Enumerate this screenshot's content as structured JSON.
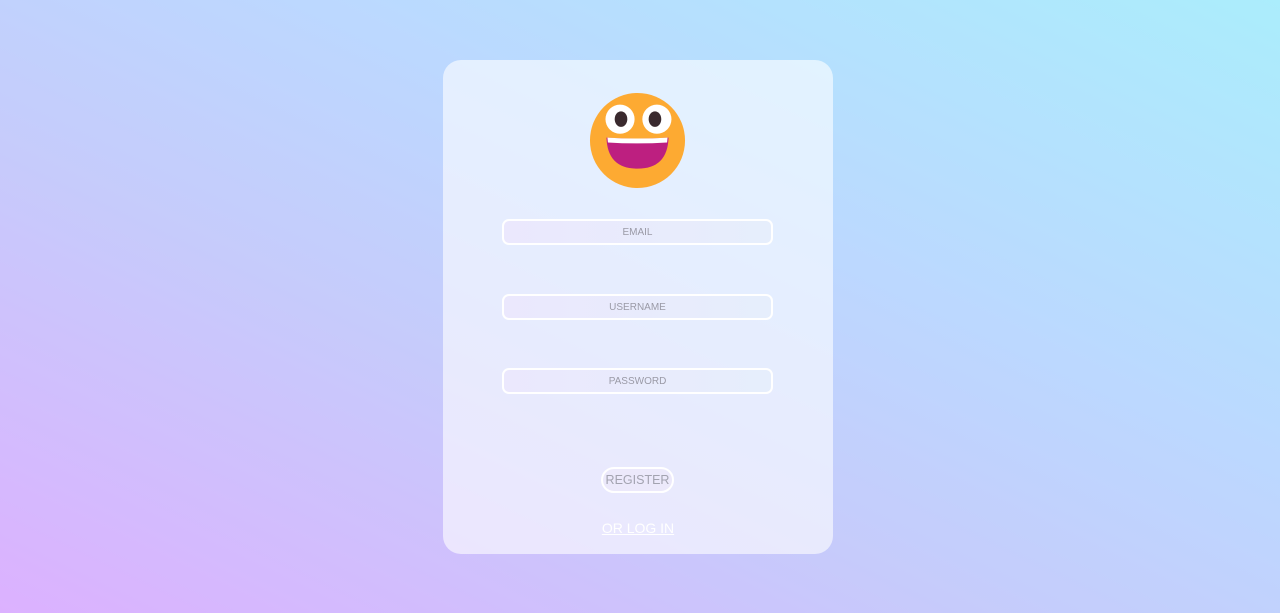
{
  "form": {
    "avatar_icon": "grinning-face-icon",
    "email_placeholder": "EMAIL",
    "username_placeholder": "USERNAME",
    "password_placeholder": "PASSWORD",
    "register_label": "REGISTER",
    "login_link_label": "OR LOG IN"
  },
  "colors": {
    "emoji_face": "#fdaa32",
    "emoji_mouth": "#bd1f80",
    "field_border": "#ffffff",
    "link": "#ffffff"
  }
}
